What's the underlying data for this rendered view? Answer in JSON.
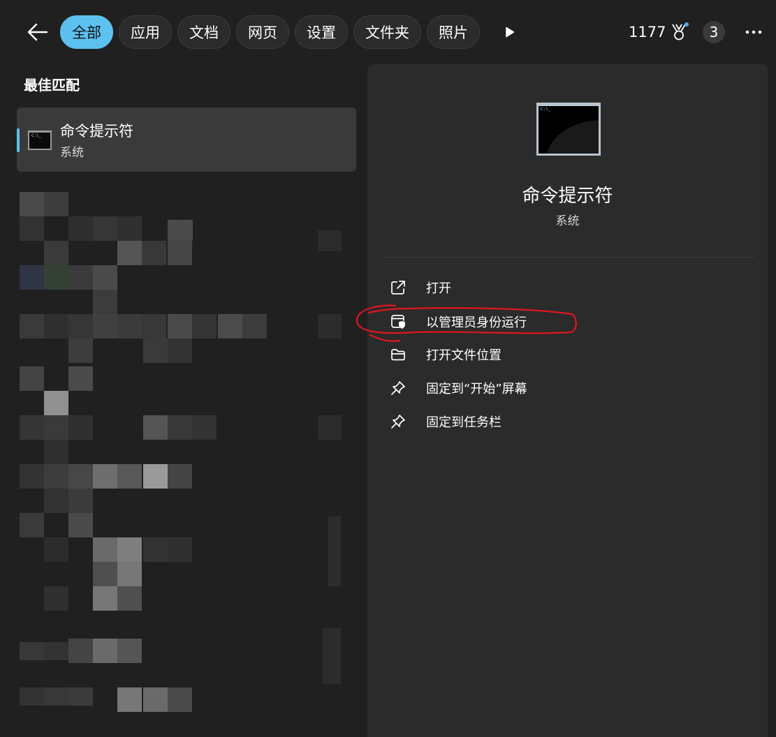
{
  "topbar": {
    "back_icon": "arrow-left-icon",
    "tabs": [
      {
        "label": "全部",
        "active": true
      },
      {
        "label": "应用",
        "active": false
      },
      {
        "label": "文档",
        "active": false
      },
      {
        "label": "网页",
        "active": false
      },
      {
        "label": "设置",
        "active": false
      },
      {
        "label": "文件夹",
        "active": false
      },
      {
        "label": "照片",
        "active": false
      }
    ],
    "more_tabs_icon": "play-triangle-icon",
    "reward_points": "1177",
    "reward_icon": "medal-icon",
    "badge_count": "3",
    "more_icon": "ellipsis-icon"
  },
  "left": {
    "section_title": "最佳匹配",
    "best_match": {
      "title": "命令提示符",
      "subtitle": "系统",
      "thumb_text": "C:\\_",
      "icon": "command-prompt-icon"
    }
  },
  "detail": {
    "title": "命令提示符",
    "subtitle": "系统",
    "thumb_text": "C:\\_",
    "actions": [
      {
        "label": "打开",
        "icon": "open-external-icon"
      },
      {
        "label": "以管理员身份运行",
        "icon": "admin-shield-icon"
      },
      {
        "label": "打开文件位置",
        "icon": "folder-icon"
      },
      {
        "label": "固定到“开始”屏幕",
        "icon": "pin-icon"
      },
      {
        "label": "固定到任务栏",
        "icon": "pin-icon"
      }
    ]
  },
  "colors": {
    "background": "#202020",
    "pane": "#2b2b2b",
    "accent": "#5dc1ef",
    "annotation": "#e0161e"
  }
}
